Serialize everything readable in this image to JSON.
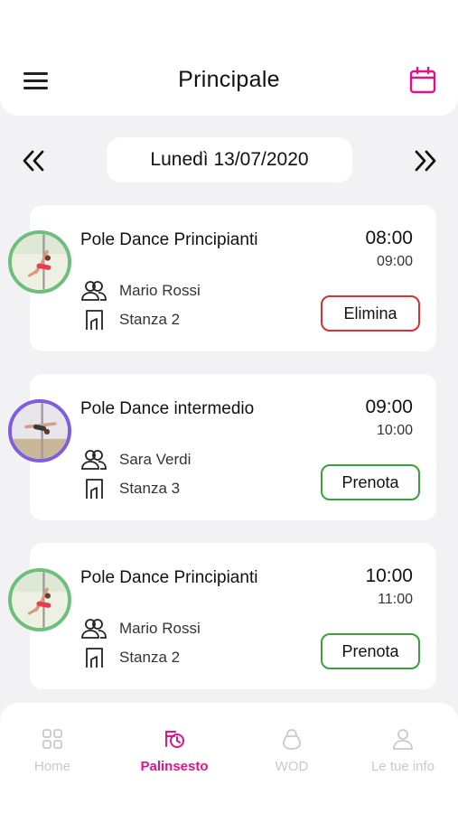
{
  "header": {
    "title": "Principale"
  },
  "date_nav": {
    "label": "Lunedì 13/07/2020"
  },
  "colors": {
    "accent": "#e5118c",
    "book_border": "#37a33a",
    "delete_border": "#e22d2d"
  },
  "lessons": [
    {
      "title": "Pole Dance Principianti",
      "start": "08:00",
      "end": "09:00",
      "teacher": "Mario Rossi",
      "room": "Stanza 2",
      "action": "Elimina"
    },
    {
      "title": "Pole Dance intermedio",
      "start": "09:00",
      "end": "10:00",
      "teacher": "Sara Verdi",
      "room": "Stanza 3",
      "action": "Prenota"
    },
    {
      "title": "Pole Dance Principianti",
      "start": "10:00",
      "end": "11:00",
      "teacher": "Mario Rossi",
      "room": "Stanza 2",
      "action": "Prenota"
    }
  ],
  "tabs": [
    {
      "label": "Home",
      "icon": "grid-icon"
    },
    {
      "label": "Palinsesto",
      "icon": "schedule-icon"
    },
    {
      "label": "WOD",
      "icon": "kettlebell-icon"
    },
    {
      "label": "Le tue info",
      "icon": "user-icon"
    }
  ]
}
